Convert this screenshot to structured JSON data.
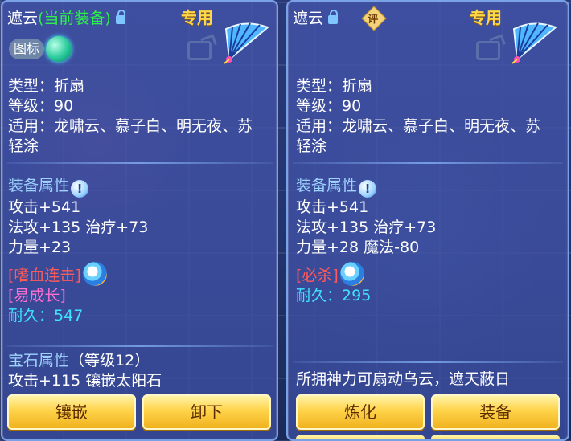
{
  "left": {
    "name": "遮云",
    "current_tag": "(当前装备)",
    "exclusive": "专用",
    "icon_chip": "图标",
    "type_line": "类型：折扇",
    "level_line": "等级：90",
    "applies_line1": "适用：龙啸云、慕子白、明无夜、苏",
    "applies_line2": "轻涂",
    "attr_header": "装备属性",
    "attr_info": "!",
    "attack": "攻击+541",
    "spell_heal": "法攻+135 治疗+73",
    "strength": "力量+23",
    "special_skill": "[嗜血连击]",
    "special_trait": "[易成长]",
    "durability_label": "耐久：",
    "durability_value": "547",
    "gem_header": "宝石属性",
    "gem_level": "（等级12）",
    "gem_line": "攻击+115 镶嵌太阳石",
    "buttons": [
      "镶嵌",
      "卸下"
    ]
  },
  "right": {
    "name": "遮云",
    "rate_badge": "评",
    "exclusive": "专用",
    "type_line": "类型：折扇",
    "level_line": "等级：90",
    "applies_line1": "适用：龙啸云、慕子白、明无夜、苏",
    "applies_line2": "轻涂",
    "attr_header": "装备属性",
    "attr_info": "!",
    "attack": "攻击+541",
    "spell_heal": "法攻+135 治疗+73",
    "strength_magic": "力量+28 魔法-80",
    "special_skill": "[必杀]",
    "durability_label": "耐久：",
    "durability_value": "295",
    "description": "所拥神力可扇动乌云，遮天蔽日",
    "buttons": [
      "炼化",
      "装备"
    ]
  },
  "colors": {
    "name": "#ffffff",
    "current_tag": "#2ef04a",
    "exclusive": "#ffd84a",
    "header": "#9fd3ff",
    "skill": "#ff5a5a",
    "trait": "#ff6fd0",
    "durability": "#41e2ff",
    "button": "#ffd34a"
  }
}
